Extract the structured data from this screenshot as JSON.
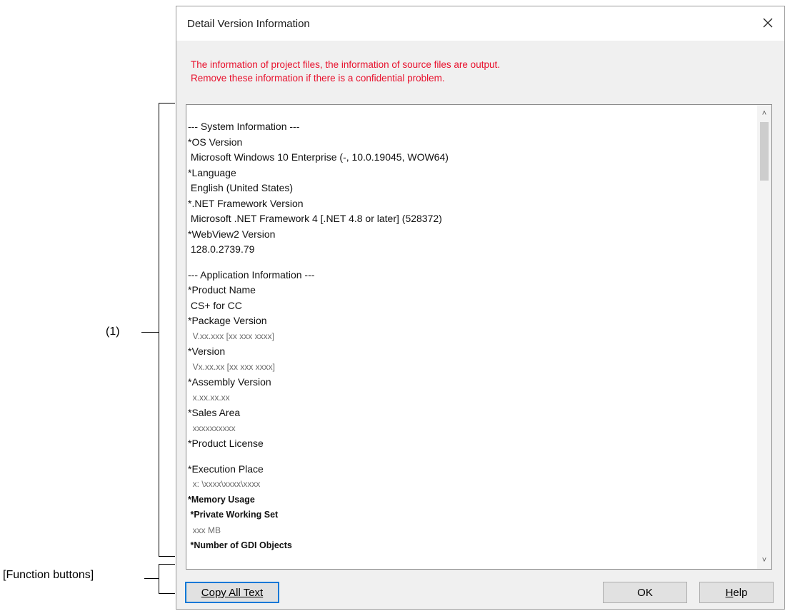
{
  "dialog": {
    "title": "Detail Version Information",
    "close_icon": "close-icon",
    "warning": [
      "The information of project files, the information of source files are output.",
      "Remove these information if there is a confidential problem."
    ]
  },
  "textarea": {
    "lines": [
      {
        "text": "--- System Information ---",
        "style": "normal"
      },
      {
        "text": "*OS Version",
        "style": "normal"
      },
      {
        "text": " Microsoft Windows 10 Enterprise (-, 10.0.19045, WOW64)",
        "style": "normal"
      },
      {
        "text": "*Language",
        "style": "normal"
      },
      {
        "text": " English (United States)",
        "style": "normal"
      },
      {
        "text": "*.NET Framework Version",
        "style": "normal"
      },
      {
        "text": " Microsoft .NET Framework 4 [.NET 4.8 or later] (528372)",
        "style": "normal"
      },
      {
        "text": "*WebView2 Version",
        "style": "normal"
      },
      {
        "text": " 128.0.2739.79",
        "style": "normal"
      },
      {
        "text": "",
        "style": "blank"
      },
      {
        "text": "--- Application Information ---",
        "style": "normal"
      },
      {
        "text": "*Product Name",
        "style": "normal"
      },
      {
        "text": " CS+ for CC",
        "style": "normal"
      },
      {
        "text": "*Package Version",
        "style": "normal"
      },
      {
        "text": "  V.xx.xxx [xx xxx xxxx]",
        "style": "dim"
      },
      {
        "text": "*Version",
        "style": "normal"
      },
      {
        "text": "  Vx.xx.xx [xx xxx xxxx]",
        "style": "dim"
      },
      {
        "text": "*Assembly Version",
        "style": "normal"
      },
      {
        "text": "  x.xx.xx.xx",
        "style": "dim"
      },
      {
        "text": "*Sales Area",
        "style": "normal"
      },
      {
        "text": "  xxxxxxxxxx",
        "style": "dim"
      },
      {
        "text": "*Product License",
        "style": "normal"
      },
      {
        "text": "",
        "style": "blank"
      },
      {
        "text": "*Execution Place",
        "style": "normal"
      },
      {
        "text": "  x: \\xxxx\\xxxx\\xxxx",
        "style": "dim"
      },
      {
        "text": "*Memory Usage",
        "style": "bold"
      },
      {
        "text": " *Private Working Set",
        "style": "bold"
      },
      {
        "text": "  xxx MB",
        "style": "dim"
      },
      {
        "text": " *Number of GDI Objects",
        "style": "bold"
      }
    ],
    "scroll_up_icon": "chevron-up-icon",
    "scroll_down_icon": "chevron-down-icon"
  },
  "buttons": {
    "copy_label": "Copy All Text",
    "ok_label": "OK",
    "help_label_u": "H",
    "help_label_rest": "elp"
  },
  "annotations": {
    "area_label": "(1)",
    "buttons_label": "[Function buttons]"
  }
}
